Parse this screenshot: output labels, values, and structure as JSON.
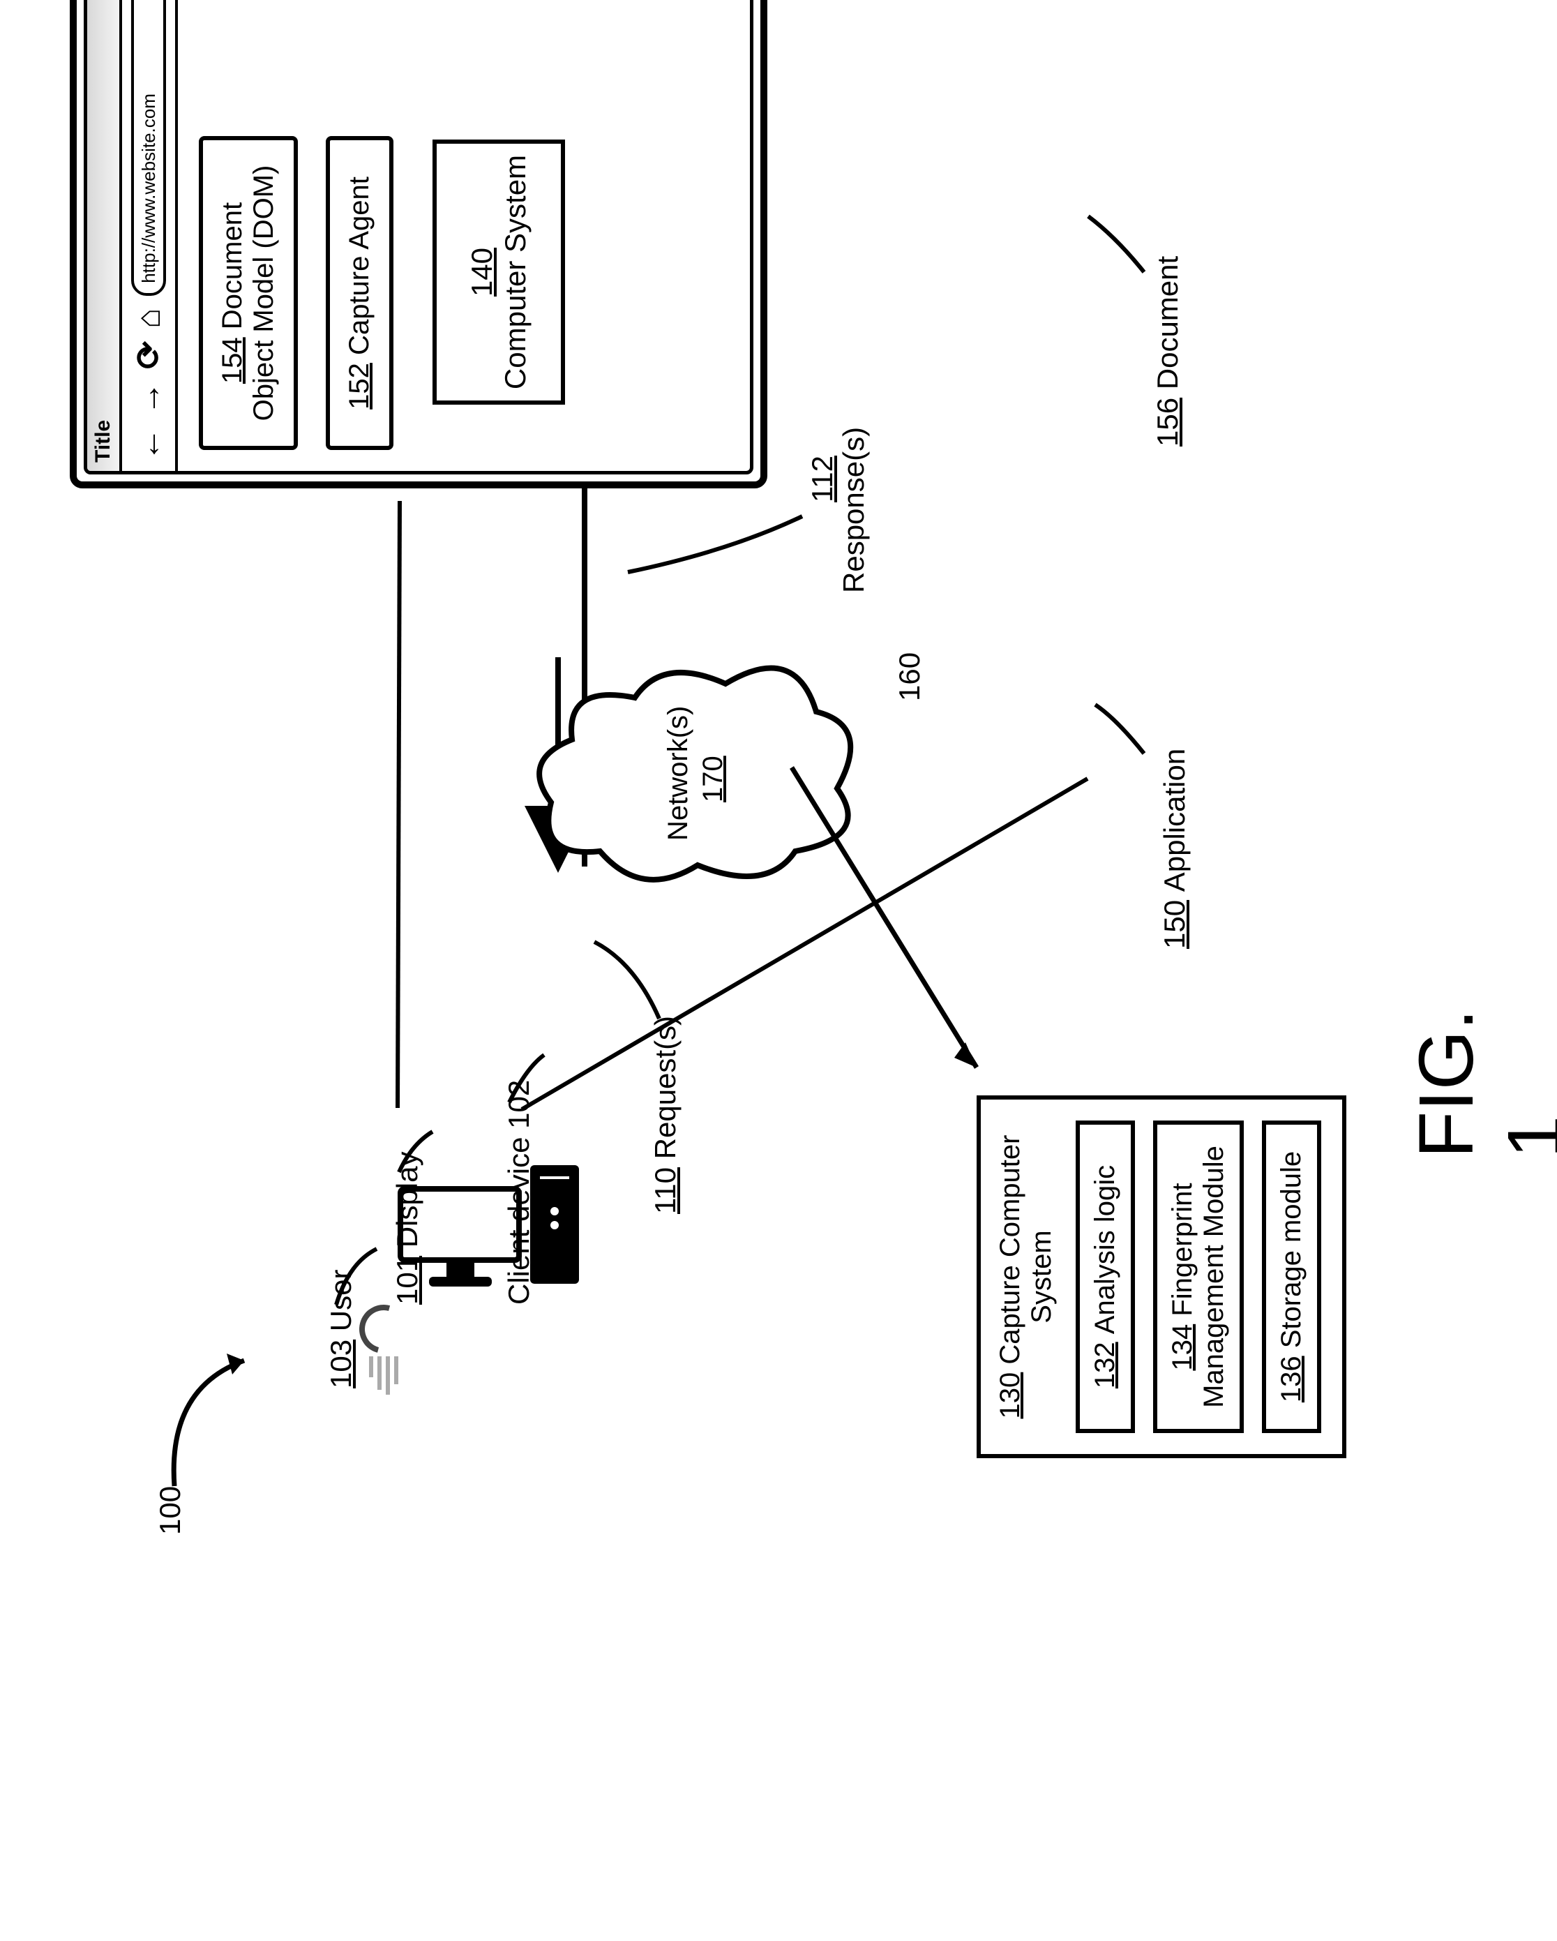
{
  "figure": {
    "label": "FIG. 1",
    "ref100": "100"
  },
  "user": {
    "ref": "103",
    "text": "User"
  },
  "display": {
    "ref": "101",
    "text": "Display"
  },
  "client": {
    "text": "Client device 102"
  },
  "request": {
    "ref": "110",
    "text": "Request(s)"
  },
  "response": {
    "ref": "112",
    "text": "Response(s)"
  },
  "network": {
    "text": "Network(s)",
    "ref": "170"
  },
  "capture_link_ref": "160",
  "computer_system": {
    "ref": "140",
    "text": "Computer System"
  },
  "capture_system": {
    "ref": "130",
    "title": "Capture Computer System",
    "analysis": {
      "ref": "132",
      "text": "Analysis logic"
    },
    "fingerprint": {
      "ref": "134",
      "text": "Fingerprint Management Module"
    },
    "storage": {
      "ref": "136",
      "text": "Storage module"
    }
  },
  "browser": {
    "title": "Title",
    "url": "http://www.website.com",
    "dom": {
      "ref": "154",
      "text": "Document Object Model (DOM)"
    },
    "agent": {
      "ref": "152",
      "text": "Capture Agent"
    }
  },
  "document": {
    "ref": "156",
    "text": "Document"
  },
  "application": {
    "ref": "150",
    "text": "Application"
  }
}
